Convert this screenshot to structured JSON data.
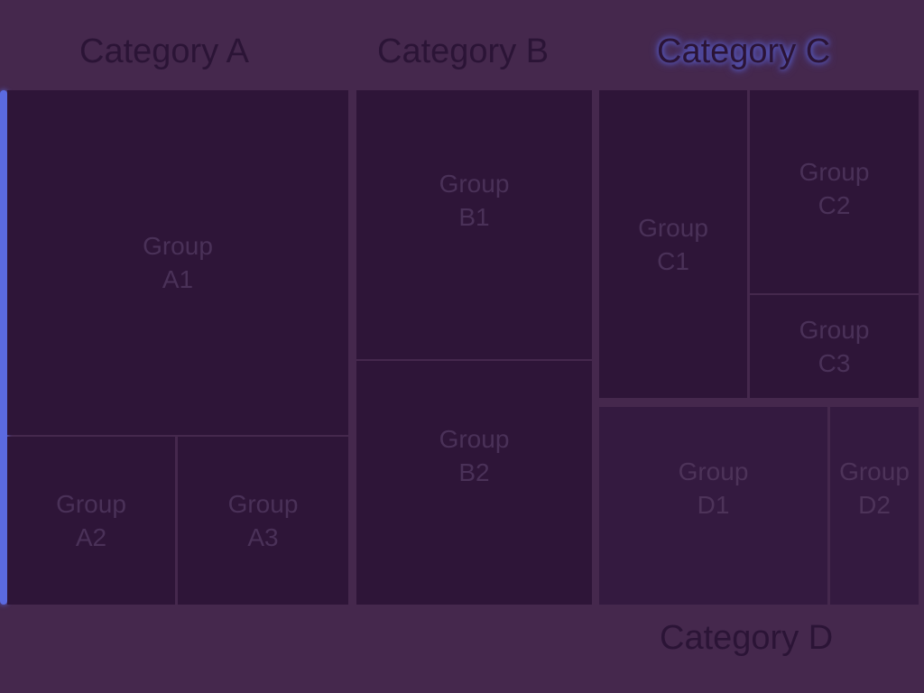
{
  "chart_data": {
    "type": "treemap",
    "title": "",
    "categories": [
      {
        "name": "Category A",
        "groups": [
          {
            "label": "Group A1"
          },
          {
            "label": "Group A2"
          },
          {
            "label": "Group A3"
          }
        ]
      },
      {
        "name": "Category B",
        "groups": [
          {
            "label": "Group B1"
          },
          {
            "label": "Group B2"
          }
        ]
      },
      {
        "name": "Category C",
        "groups": [
          {
            "label": "Group C1"
          },
          {
            "label": "Group C2"
          },
          {
            "label": "Group C3"
          }
        ]
      },
      {
        "name": "Category D",
        "groups": [
          {
            "label": "Group D1"
          },
          {
            "label": "Group D2"
          }
        ]
      }
    ]
  },
  "colors": {
    "background": "#45284d",
    "cell": "#2e1538",
    "highlight": "#5b6ae0"
  }
}
